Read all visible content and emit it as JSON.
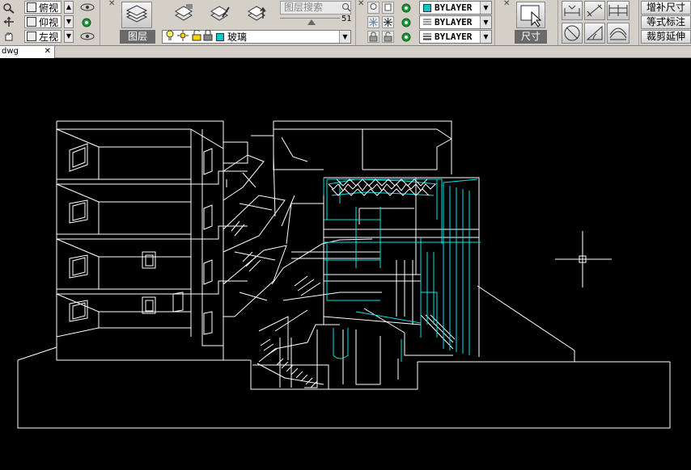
{
  "views": [
    {
      "label": "俯视"
    },
    {
      "label": "仰视"
    },
    {
      "label": "左视"
    }
  ],
  "layer_panel": {
    "label": "图层",
    "search_placeholder": "图层搜索",
    "slider_value": "51",
    "current_layer": "玻璃"
  },
  "properties": {
    "color": "BYLAYER",
    "linetype": "BYLAYER",
    "lineweight": "BYLAYER",
    "color_swatch": "#00c8c8"
  },
  "dim_panel": {
    "label": "尺寸"
  },
  "right_buttons": [
    {
      "label": "增补尺寸"
    },
    {
      "label": "等式标注"
    },
    {
      "label": "裁剪延伸"
    }
  ],
  "document_tab": {
    "name": "dwg"
  },
  "colors": {
    "background": "#000000",
    "lines_white": "#ffffff",
    "lines_cyan": "#00e5e5",
    "crosshair": "#ffffff"
  }
}
